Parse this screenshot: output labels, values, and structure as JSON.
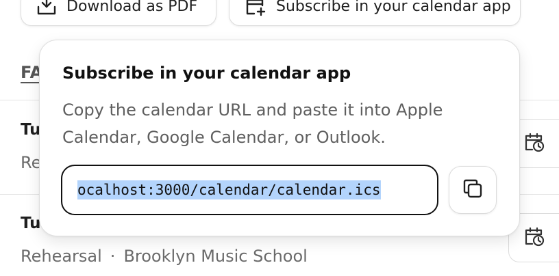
{
  "toolbar": {
    "download_label": "Download as PDF",
    "subscribe_label": "Subscribe in your calendar app"
  },
  "list": {
    "section_label": "FA",
    "events": [
      {
        "title": "Tu",
        "meta": "Re"
      },
      {
        "title": "Tu",
        "type": "Rehearsal",
        "location": "Brooklyn Music School"
      }
    ],
    "separator": "·"
  },
  "popover": {
    "title": "Subscribe in your calendar app",
    "description": "Copy the calendar URL and paste it into Apple Calendar, Google Calendar, or Outlook.",
    "url_visible": "ocalhost:3000/calendar/calendar.ics",
    "copy_icon": "copy-icon"
  },
  "icons": {
    "download": "download-icon",
    "calendar_add": "calendar-plus-icon",
    "calendar_clock": "calendar-clock-icon"
  }
}
